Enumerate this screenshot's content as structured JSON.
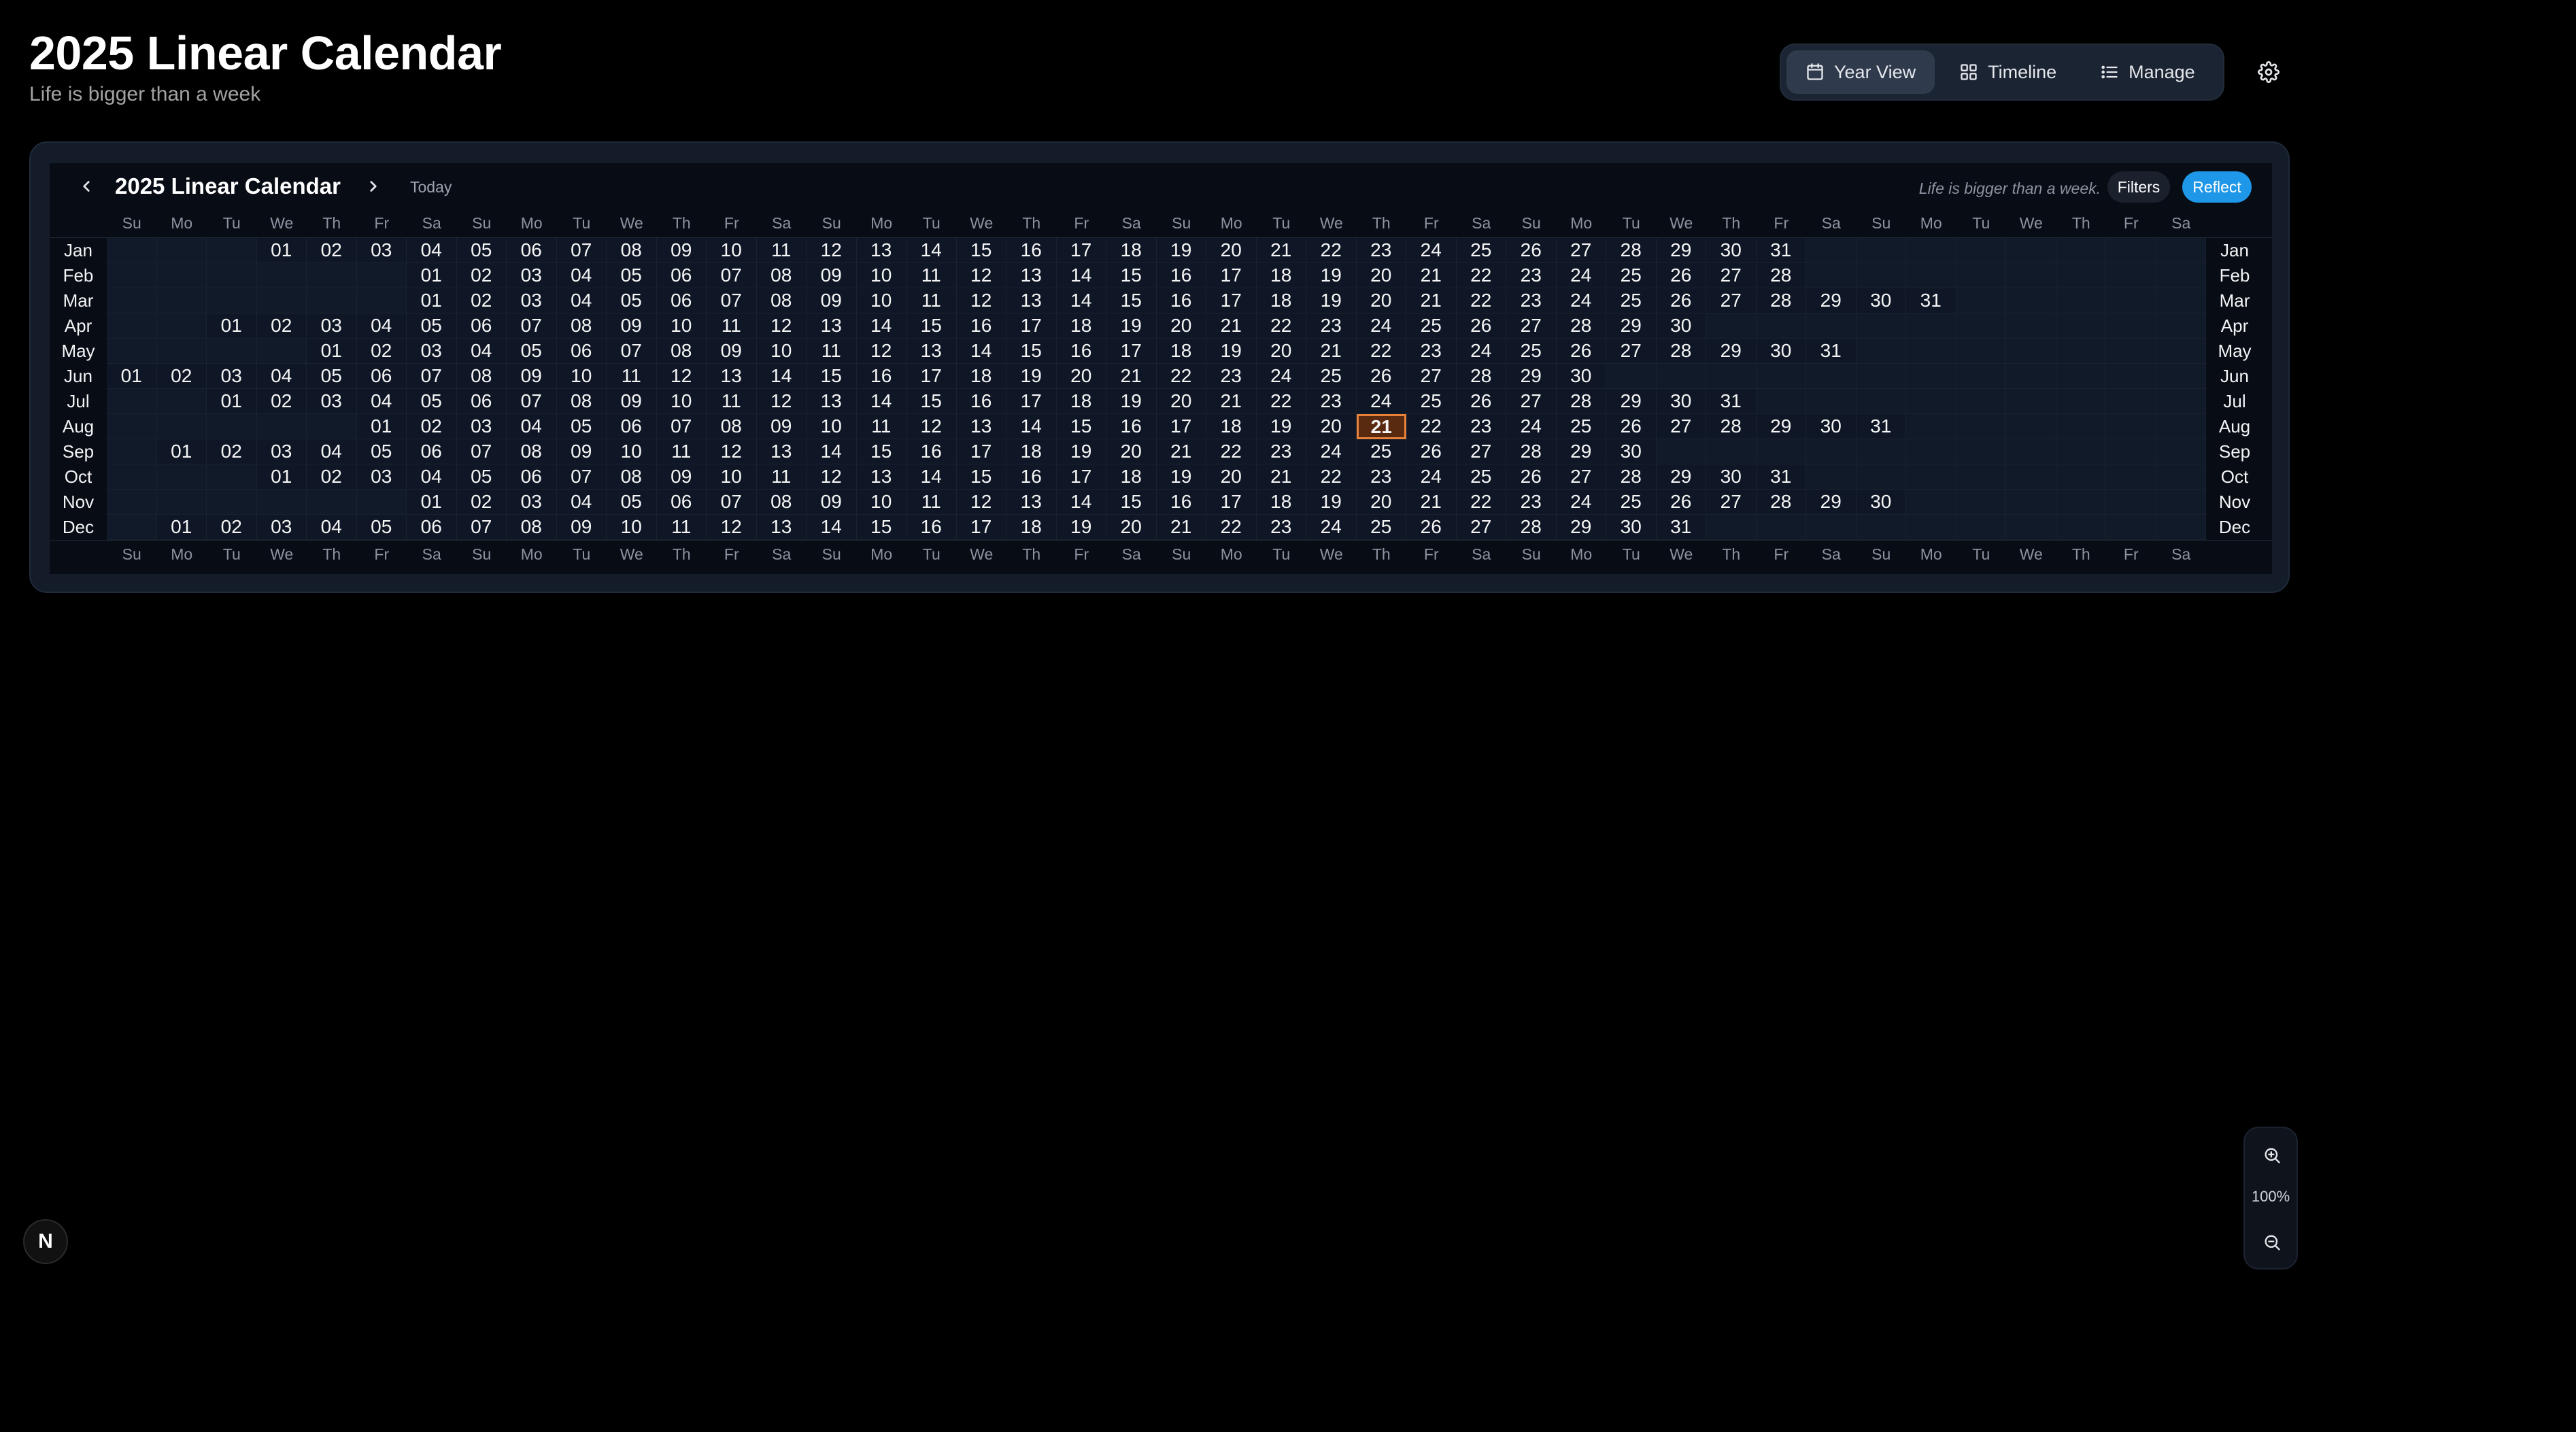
{
  "app": {
    "title": "2025 Linear Calendar",
    "subtitle": "Life is bigger than a week"
  },
  "views": [
    {
      "label": "Year View",
      "icon": "calendar-icon",
      "active": true
    },
    {
      "label": "Timeline",
      "icon": "grid-icon",
      "active": false
    },
    {
      "label": "Manage",
      "icon": "list-icon",
      "active": false
    }
  ],
  "settings": {
    "icon": "gear-icon"
  },
  "calendar": {
    "title": "2025 Linear Calendar",
    "today_label": "Today",
    "tagline": "Life is bigger than a week.",
    "filters_label": "Filters",
    "reflect_label": "Reflect",
    "weekdays": [
      "Su",
      "Mo",
      "Tu",
      "We",
      "Th",
      "Fr",
      "Sa"
    ],
    "columns": 42,
    "today": {
      "month": "Aug",
      "day": "21"
    },
    "months": [
      {
        "name": "Jan",
        "offset": 3,
        "days": 31
      },
      {
        "name": "Feb",
        "offset": 6,
        "days": 28
      },
      {
        "name": "Mar",
        "offset": 6,
        "days": 31
      },
      {
        "name": "Apr",
        "offset": 2,
        "days": 30
      },
      {
        "name": "May",
        "offset": 4,
        "days": 31
      },
      {
        "name": "Jun",
        "offset": 0,
        "days": 30
      },
      {
        "name": "Jul",
        "offset": 2,
        "days": 31
      },
      {
        "name": "Aug",
        "offset": 5,
        "days": 31
      },
      {
        "name": "Sep",
        "offset": 1,
        "days": 30
      },
      {
        "name": "Oct",
        "offset": 3,
        "days": 31
      },
      {
        "name": "Nov",
        "offset": 6,
        "days": 30
      },
      {
        "name": "Dec",
        "offset": 1,
        "days": 31
      }
    ]
  },
  "colors": {
    "accent": "#1e97e8",
    "today_fill": "#5a2a10",
    "today_border": "#e8823b",
    "card_bg": "#141c2a",
    "grid_bg": "#080c14"
  },
  "brand": {
    "label": "N"
  },
  "zoom": {
    "level": "100%"
  }
}
